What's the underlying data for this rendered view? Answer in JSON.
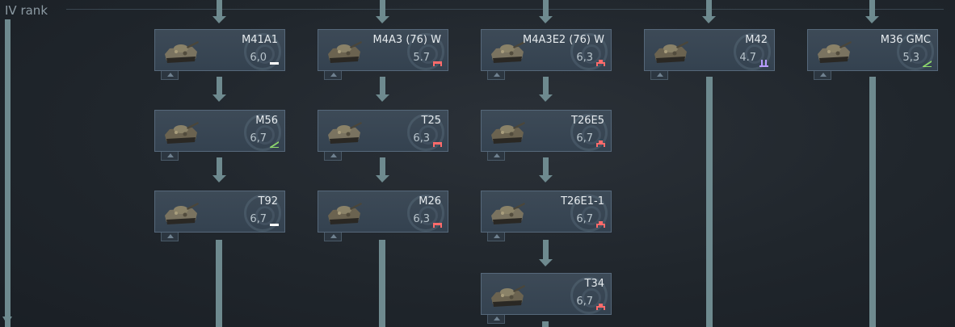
{
  "rank": {
    "label": "IV rank"
  },
  "colors": {
    "light": "#ffffff",
    "medium": "#ff6b6b",
    "heavy": "#ff6b6b",
    "spaa": "#b89cff",
    "td": "#8fdc6a",
    "line": "#6e8a8f",
    "card": "#3a4856"
  },
  "vehicles": [
    {
      "name": "M41A1",
      "br": "6,0",
      "role": "light",
      "role_icon": "light-tank-icon"
    },
    {
      "name": "M4A3 (76) W",
      "br": "5.7",
      "role": "medium",
      "role_icon": "medium-tank-icon"
    },
    {
      "name": "M4A3E2 (76) W",
      "br": "6,3",
      "role": "heavy",
      "role_icon": "heavy-tank-icon"
    },
    {
      "name": "M42",
      "br": "4.7",
      "role": "spaa",
      "role_icon": "spaa-icon"
    },
    {
      "name": "M36 GMC",
      "br": "5,3",
      "role": "td",
      "role_icon": "tank-destroyer-icon"
    },
    {
      "name": "M56",
      "br": "6,7",
      "role": "td",
      "role_icon": "tank-destroyer-icon"
    },
    {
      "name": "T25",
      "br": "6,3",
      "role": "medium",
      "role_icon": "medium-tank-icon"
    },
    {
      "name": "T26E5",
      "br": "6,7",
      "role": "heavy",
      "role_icon": "heavy-tank-icon"
    },
    {
      "name": "T92",
      "br": "6,7",
      "role": "light",
      "role_icon": "light-tank-icon"
    },
    {
      "name": "M26",
      "br": "6,3",
      "role": "medium",
      "role_icon": "medium-tank-icon"
    },
    {
      "name": "T26E1-1",
      "br": "6,7",
      "role": "heavy",
      "role_icon": "heavy-tank-icon"
    },
    {
      "name": "T34",
      "br": "6,7",
      "role": "heavy",
      "role_icon": "heavy-tank-icon"
    }
  ]
}
